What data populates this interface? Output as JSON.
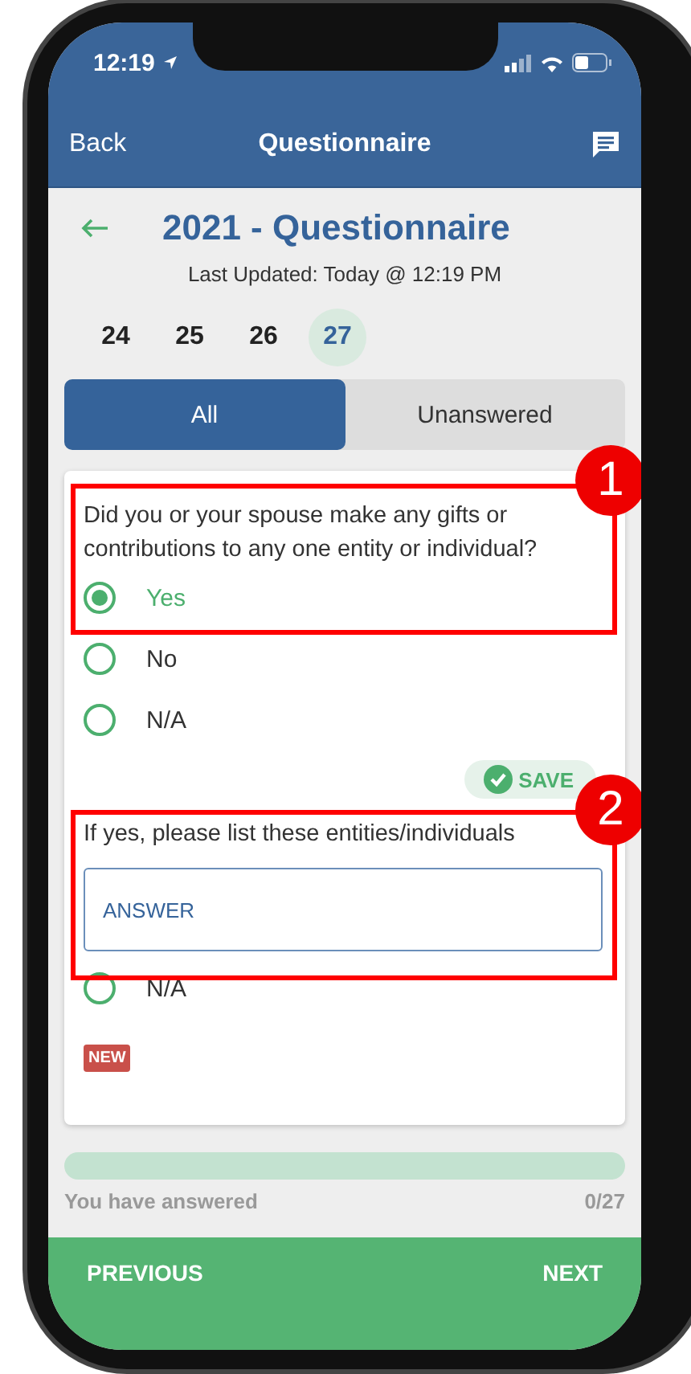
{
  "status_bar": {
    "time": "12:19"
  },
  "nav_bar": {
    "back": "Back",
    "title": "Questionnaire"
  },
  "header": {
    "title": "2021 - Questionnaire",
    "updated": "Last Updated: Today @ 12:19 PM"
  },
  "pages": [
    {
      "label": "24",
      "selected": false
    },
    {
      "label": "25",
      "selected": false
    },
    {
      "label": "26",
      "selected": false
    },
    {
      "label": "27",
      "selected": true
    }
  ],
  "filter_tabs": [
    {
      "label": "All",
      "selected": true
    },
    {
      "label": "Unanswered",
      "selected": false
    }
  ],
  "questions": [
    {
      "kind": "choice",
      "prompt": "Did you or your spouse make any gifts or contributions to any one entity or individual?",
      "options": [
        {
          "label": "Yes",
          "selected": true
        },
        {
          "label": "No",
          "selected": false
        },
        {
          "label": "N/A",
          "selected": false
        }
      ],
      "status": "SAVE"
    },
    {
      "kind": "text",
      "prompt": "If yes, please list these entities/individuals",
      "placeholder": "ANSWER",
      "options": [
        {
          "label": "N/A",
          "selected": false
        }
      ],
      "badge": "NEW"
    }
  ],
  "progress": {
    "level": 0,
    "label": "You have answered",
    "count": "0/27"
  },
  "footer": {
    "previous": "PREVIOUS",
    "next": "NEXT"
  },
  "annotations": [
    {
      "number": "1"
    },
    {
      "number": "2"
    }
  ]
}
